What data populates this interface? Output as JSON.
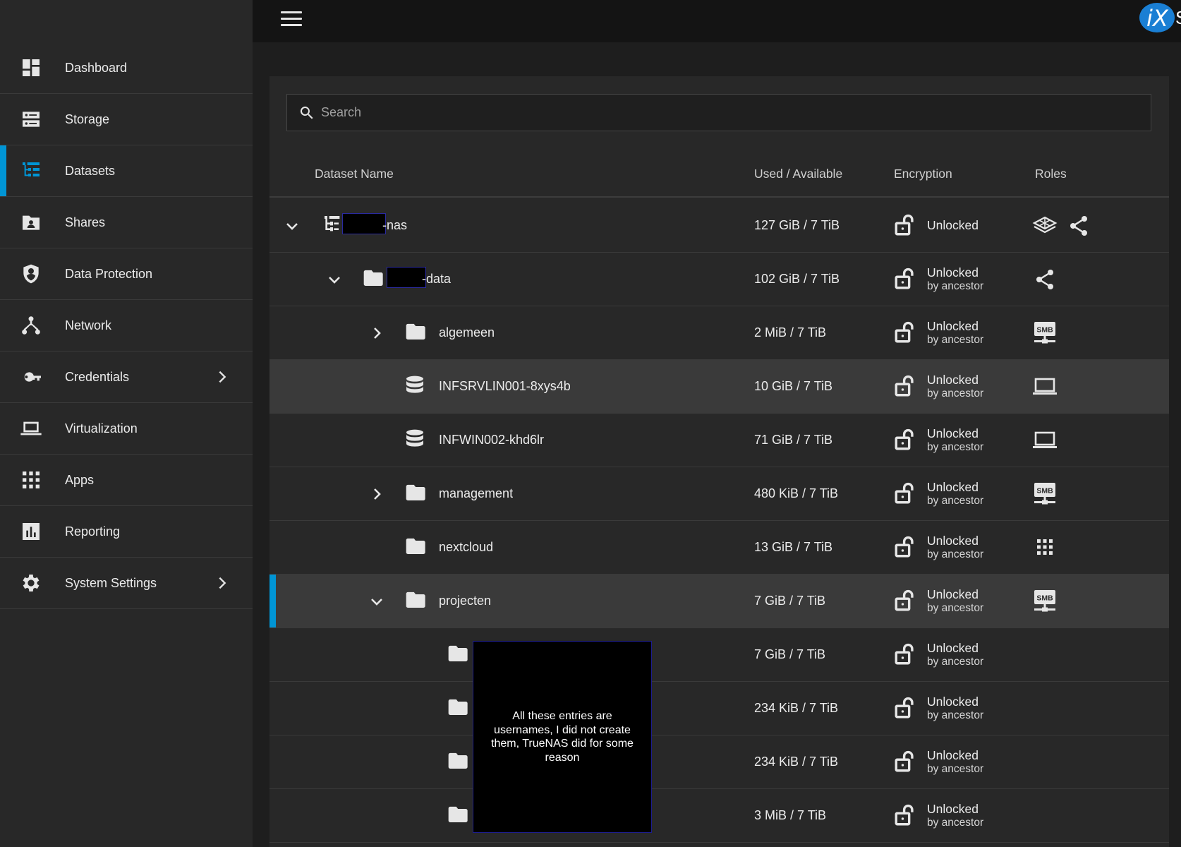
{
  "topbar": {
    "menu_icon": "hamburger-menu-icon",
    "logo_text": "iX",
    "logo_extra": "S"
  },
  "sidebar": {
    "items": [
      {
        "label": "Dashboard",
        "icon": "dashboard-icon"
      },
      {
        "label": "Storage",
        "icon": "storage-icon"
      },
      {
        "label": "Datasets",
        "icon": "datasets-tree-icon",
        "active": true
      },
      {
        "label": "Shares",
        "icon": "shares-folder-icon"
      },
      {
        "label": "Data Protection",
        "icon": "shield-icon"
      },
      {
        "label": "Network",
        "icon": "network-icon"
      },
      {
        "label": "Credentials",
        "icon": "key-icon",
        "has_submenu": true
      },
      {
        "label": "Virtualization",
        "icon": "laptop-icon"
      },
      {
        "label": "Apps",
        "icon": "apps-grid-icon"
      },
      {
        "label": "Reporting",
        "icon": "bar-chart-icon"
      },
      {
        "label": "System Settings",
        "icon": "gear-icon",
        "has_submenu": true
      }
    ]
  },
  "search": {
    "placeholder": "Search",
    "value": ""
  },
  "table": {
    "headers": {
      "name": "Dataset Name",
      "used": "Used / Available",
      "encryption": "Encryption",
      "roles": "Roles"
    },
    "rows": [
      {
        "name": "-nas",
        "used": "127 GiB / 7 TiB",
        "status": "Unlocked",
        "sub": "",
        "icon": "dataset-root-icon",
        "expander": "expanded",
        "roles": [
          "apps-cube-icon",
          "share-icon"
        ]
      },
      {
        "name": "-data",
        "used": "102 GiB / 7 TiB",
        "status": "Unlocked",
        "sub": "by ancestor",
        "icon": "folder-icon",
        "expander": "expanded",
        "roles": [
          "share-icon"
        ]
      },
      {
        "name": "algemeen",
        "used": "2 MiB / 7 TiB",
        "status": "Unlocked",
        "sub": "by ancestor",
        "icon": "folder-icon",
        "expander": "collapsed",
        "roles": [
          "smb-share-icon"
        ]
      },
      {
        "name": "INFSRVLIN001-8xys4b",
        "used": "10 GiB / 7 TiB",
        "status": "Unlocked",
        "sub": "by ancestor",
        "icon": "zvol-database-icon",
        "expander": "none",
        "roles": [
          "vm-laptop-icon"
        ]
      },
      {
        "name": "INFWIN002-khd6lr",
        "used": "71 GiB / 7 TiB",
        "status": "Unlocked",
        "sub": "by ancestor",
        "icon": "zvol-database-icon",
        "expander": "none",
        "roles": [
          "vm-laptop-icon"
        ]
      },
      {
        "name": "management",
        "used": "480 KiB / 7 TiB",
        "status": "Unlocked",
        "sub": "by ancestor",
        "icon": "folder-icon",
        "expander": "collapsed",
        "roles": [
          "smb-share-icon"
        ]
      },
      {
        "name": "nextcloud",
        "used": "13 GiB / 7 TiB",
        "status": "Unlocked",
        "sub": "by ancestor",
        "icon": "folder-icon",
        "expander": "none",
        "roles": [
          "apps-grid-icon"
        ]
      },
      {
        "name": "projecten",
        "used": "7 GiB / 7 TiB",
        "status": "Unlocked",
        "sub": "by ancestor",
        "icon": "folder-icon",
        "expander": "expanded",
        "roles": [
          "smb-share-icon"
        ]
      },
      {
        "name": "",
        "used": "7 GiB / 7 TiB",
        "status": "Unlocked",
        "sub": "by ancestor",
        "icon": "folder-icon",
        "expander": "none",
        "roles": []
      },
      {
        "name": "",
        "used": "234 KiB / 7 TiB",
        "status": "Unlocked",
        "sub": "by ancestor",
        "icon": "folder-icon",
        "expander": "none",
        "roles": []
      },
      {
        "name": "",
        "used": "234 KiB / 7 TiB",
        "status": "Unlocked",
        "sub": "by ancestor",
        "icon": "folder-icon",
        "expander": "none",
        "roles": []
      },
      {
        "name": "",
        "used": "3 MiB / 7 TiB",
        "status": "Unlocked",
        "sub": "by ancestor",
        "icon": "folder-icon",
        "expander": "none",
        "roles": []
      }
    ]
  },
  "annotation": {
    "text": "All these entries are usernames, I did not create them, TrueNAS did for some reason"
  },
  "colors": {
    "accent": "#0095d5",
    "sidebar_bg": "#282828",
    "topbar_bg": "#141414",
    "page_bg": "#1e1e1e",
    "row_highlight": "#3a3a3a"
  }
}
